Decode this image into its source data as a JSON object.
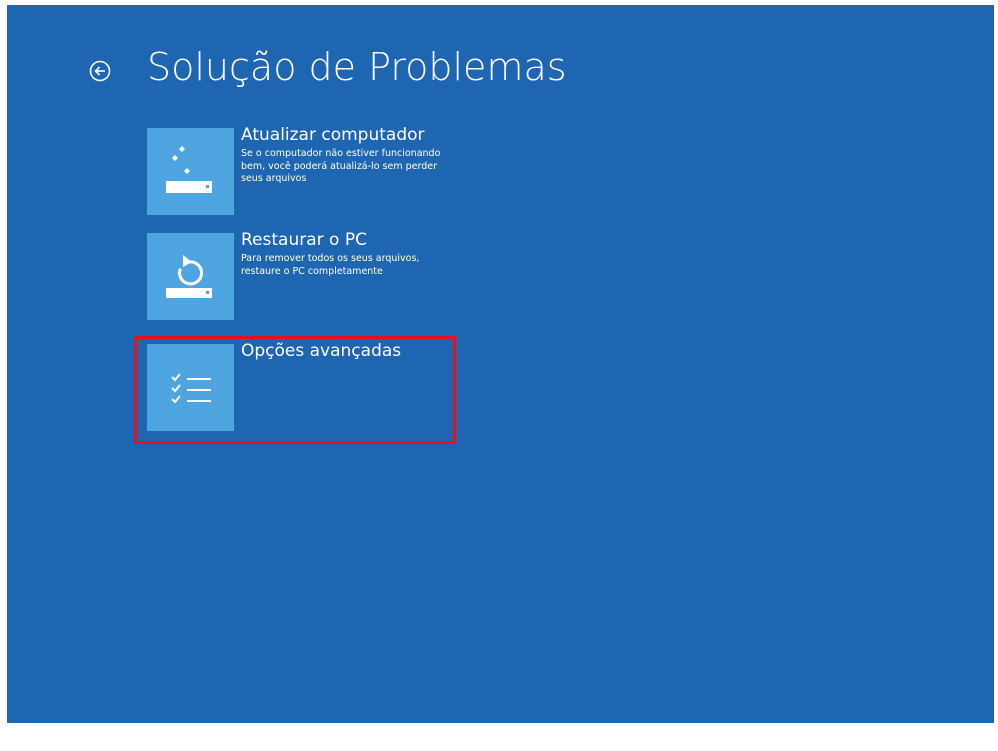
{
  "header": {
    "title": "Solução de Problemas"
  },
  "options": [
    {
      "title": "Atualizar computador",
      "description": "Se o computador não estiver funcionando bem, você poderá atualizá-lo sem perder seus arquivos",
      "icon": "refresh-pc-icon"
    },
    {
      "title": "Restaurar o PC",
      "description": "Para remover todos os seus arquivos, restaure o PC completamente",
      "icon": "reset-pc-icon"
    },
    {
      "title": "Opções avançadas",
      "description": "",
      "icon": "checklist-icon",
      "highlighted": true
    }
  ],
  "colors": {
    "background": "#1f66b2",
    "tile": "#4ea5e0",
    "text": "#ffffff",
    "highlight": "#e8101a"
  }
}
